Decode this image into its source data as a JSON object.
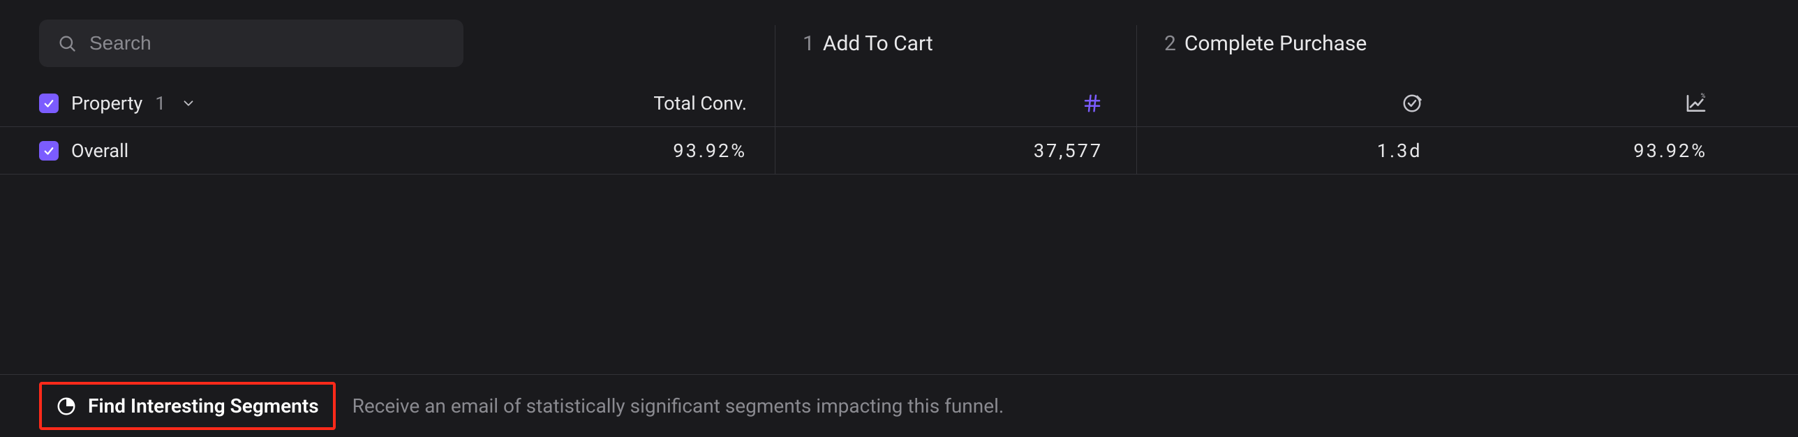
{
  "search": {
    "placeholder": "Search"
  },
  "steps": [
    {
      "num": "1",
      "name": "Add To Cart"
    },
    {
      "num": "2",
      "name": "Complete Purchase"
    }
  ],
  "columns": {
    "property_label": "Property",
    "property_count": "1",
    "total_conv_label": "Total Conv."
  },
  "rows": [
    {
      "label": "Overall",
      "total_conv": "93.92%",
      "step1_count": "37,577",
      "step2_time": "1.3d",
      "step2_rate": "93.92%"
    }
  ],
  "footer": {
    "button_label": "Find Interesting Segments",
    "description": "Receive an email of statistically significant segments impacting this funnel."
  }
}
